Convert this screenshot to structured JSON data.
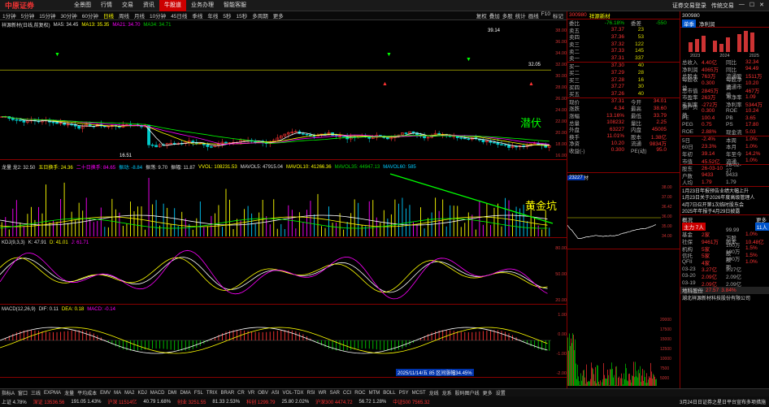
{
  "nav": {
    "items": [
      "全景图",
      "行情",
      "交易",
      "资讯",
      "牛股道",
      "业务办理",
      "智能客服"
    ],
    "active_index": 4,
    "right": [
      "证券交易登录",
      "传统交易"
    ]
  },
  "periods": [
    "1分钟",
    "5分钟",
    "15分钟",
    "30分钟",
    "60分钟",
    "日线",
    "周线",
    "月线",
    "10分钟",
    "45日线",
    "季线",
    "年线",
    "5秒",
    "15秒",
    "多周期",
    "更多"
  ],
  "period_active": 5,
  "period_right": [
    "复权",
    "叠加",
    "多股",
    "统计",
    "画线",
    "F10",
    "标记"
  ],
  "stock": {
    "code": "300980",
    "name": "祥源新材",
    "title": "祥源新材(日线,前复权)"
  },
  "main_ma": {
    "label": "MA5: 34.45",
    "ma13": "MA13: 35.35",
    "ma21": "MA21: 34.70",
    "ma34": "MA34: 34.71"
  },
  "main_price_labels": {
    "high": "39.14",
    "low": "16.51",
    "mid": "32.05"
  },
  "main_yaxis": [
    "38.00",
    "36.00",
    "34.00",
    "32.00",
    "30.00",
    "28.00",
    "26.00",
    "24.00",
    "22.00",
    "20.00",
    "18.00",
    "16.00"
  ],
  "annotations": {
    "hidden": "潜伏",
    "pit": "黄金坑"
  },
  "dragon": {
    "label": "龙量 龙2: 32.50",
    "a": "五日换手: 24.36",
    "b": "二十日换手: 84.65",
    "c": "振动: -8.84",
    "d": "振荡: 9.70",
    "e": "振幅: 11.87",
    "vol": "VVOL: 108231.53",
    "mavol5": "MAVOL5: 47915.04",
    "mavol10": "MAVOL10: 41266.36",
    "mavol35": "MAVOL35: 44947.13",
    "mavol60": "MAVOL60: 585"
  },
  "kdj": {
    "label": "KDJ(9,3,3)",
    "k": "K: 47.91",
    "d": "D: 41.01",
    "j": "J: 61.71",
    "y": [
      "80.00",
      "50.00",
      "20.00"
    ]
  },
  "macd": {
    "label": "MACD(12,26,9)",
    "dif": "DIF: 0.11",
    "dea": "DEA: 0.18",
    "macd": "MACD: -0.14",
    "date_tag": "2025/11/14/五 85 区间涨幅34.45%",
    "y": [
      "1.00",
      "0.00",
      "-1.00",
      "-2.00"
    ]
  },
  "quote": {
    "title": "300980 祥源新材",
    "weibi": "委比",
    "weibi_v": "-76.18%",
    "weicha": "委差",
    "weicha_v": "-550",
    "asks": [
      [
        "卖五",
        "37.37",
        "23"
      ],
      [
        "卖四",
        "37.36",
        "53"
      ],
      [
        "卖三",
        "37.32",
        "122"
      ],
      [
        "卖二",
        "37.33",
        "145"
      ],
      [
        "卖一",
        "37.31",
        "337"
      ]
    ],
    "bids": [
      [
        "买一",
        "37.30",
        "40"
      ],
      [
        "买二",
        "37.29",
        "28"
      ],
      [
        "买三",
        "37.28",
        "16"
      ],
      [
        "买四",
        "37.27",
        "30"
      ],
      [
        "买五",
        "37.26",
        "40"
      ]
    ],
    "stats": [
      [
        "现价",
        "37.31",
        "今开",
        "34.01"
      ],
      [
        "涨跌",
        "4.34",
        "最高",
        "38.60"
      ],
      [
        "涨幅",
        "13.16%",
        "最低",
        "33.79"
      ],
      [
        "总量",
        "108232",
        "量比",
        "2.25"
      ],
      [
        "外盘",
        "63227",
        "内盘",
        "45005"
      ],
      [
        "换手",
        "11.01%",
        "股本",
        "1.38亿"
      ],
      [
        "净资",
        "10.20",
        "流通",
        "9834万"
      ],
      [
        "收益(-)",
        "0.300",
        "PE(动)",
        "95.0"
      ]
    ]
  },
  "mini_chart": {
    "title": "祥源新材",
    "vol": "23227",
    "y": [
      "38.00",
      "37.00",
      "36.42",
      "36.00",
      "35.00",
      "34.00"
    ],
    "ylow": [
      "20000",
      "17500",
      "15000",
      "12500",
      "10000",
      "7500",
      "5000"
    ]
  },
  "board": {
    "tabs": [
      "概况",
      "更多"
    ],
    "rows": [
      [
        "1月23日年报预告业绩大幅上升"
      ],
      [
        "1月23日关于2026年度回购"
      ],
      [
        "4月7日召开第1次临时股东会"
      ],
      [
        "2025年年报于4月29日披露"
      ]
    ],
    "pill": "主力 7人",
    "pill2": "11人"
  },
  "far": {
    "code": "300980",
    "tabs": [
      "单季",
      "净利润"
    ],
    "years": [
      "2023",
      "2024",
      "2025"
    ],
    "rows": [
      [
        "总收入",
        "4.40亿",
        "同比",
        "32.34"
      ],
      [
        "净利润",
        "4065万",
        "同比",
        "94.49"
      ],
      [
        "总股本",
        "763万",
        "流通股",
        "1511万"
      ],
      [
        "每股收益",
        "0.300",
        "每股净资",
        "10.20"
      ],
      [
        "总市值",
        "2845万",
        "流通市值",
        "467万"
      ],
      [
        "市盈率",
        "263万",
        "市净率",
        "1.09"
      ],
      [
        "毛利率",
        "-272万",
        "净利率",
        "5344万"
      ],
      [
        "资产负债",
        "0.300",
        "ROE",
        "10.24"
      ],
      [
        "PE",
        "100.4",
        "PB",
        "3.65"
      ],
      [
        "PEG",
        "0.75",
        "PS",
        "17.80"
      ],
      [
        "ROE",
        "2.88%",
        "现金流",
        "5.03"
      ]
    ],
    "perf": [
      [
        "5日",
        "-2.4%",
        "本周",
        "1.0%"
      ],
      [
        "60日",
        "23.3%",
        "本月",
        "1.0%"
      ],
      [
        "年初",
        "39.14",
        "年至今",
        "14.2%"
      ],
      [
        "市值",
        "45.52亿",
        "流通",
        "1.0%"
      ]
    ],
    "fx": [
      [
        "股东",
        "26-03-10",
        "26-02-27"
      ],
      [
        "户数",
        "9433",
        "9433"
      ],
      [
        "人均",
        "1.79",
        "1.79"
      ]
    ],
    "news": [
      "1月23日年报预告业绩大幅上升",
      "1月23日关于2026年度高级管理人",
      "4月7日召开第1次临时股东会",
      "2025年年报于4月29日披露"
    ],
    "table": [
      [
        "基金",
        "2家",
        "99.99万股",
        "1.0%"
      ],
      [
        "社保",
        "9461万",
        "股本",
        "10.48亿"
      ],
      [
        "机构",
        "5家",
        "100万股",
        "1.5%"
      ],
      [
        "信托",
        "5家",
        "100万股",
        "1.5%"
      ],
      [
        "QFII",
        "4家",
        "100万股",
        "1.0%"
      ],
      [
        "03-23",
        "3.27亿",
        "3.27亿"
      ],
      [
        "03-20",
        "2.09亿",
        "2.09亿"
      ],
      [
        "03-19",
        "2.09亿",
        "2.09亿"
      ]
    ],
    "bottom": [
      "地科股份",
      "27.57",
      "3.84%"
    ],
    "company": "湖北祥源新材科技股份有限公司"
  },
  "indicators": [
    "指标A",
    "窗口",
    "三线",
    "EXPMA",
    "龙量",
    "平均成本",
    "EMV",
    "MA",
    "MA2",
    "KDJ",
    "MACD",
    "DMI",
    "DMA",
    "FSL",
    "TRIX",
    "BRAR",
    "CR",
    "VR",
    "OBV",
    "ASI",
    "VOL-TDX",
    "RSI",
    "WR",
    "SAR",
    "CCI",
    "ROC",
    "MTM",
    "BOLL",
    "PSY",
    "MCST",
    "龙线",
    "龙系",
    "股码图户线",
    "更多",
    "设置"
  ],
  "ticker": [
    "上证 4.78%",
    "深证 13536.56",
    "191.05 1.43%",
    "沪深 11514亿",
    "40.79 1.68%",
    "创业 3251.55",
    "81.33 2.53%",
    "科创 1299.79",
    "25.80 2.02%",
    "沪深300 4474.72",
    "56.72 1.28%",
    "中证500 7565.32"
  ],
  "ticker_right": "3月24日日证券之星日平台宣布多项措施"
}
